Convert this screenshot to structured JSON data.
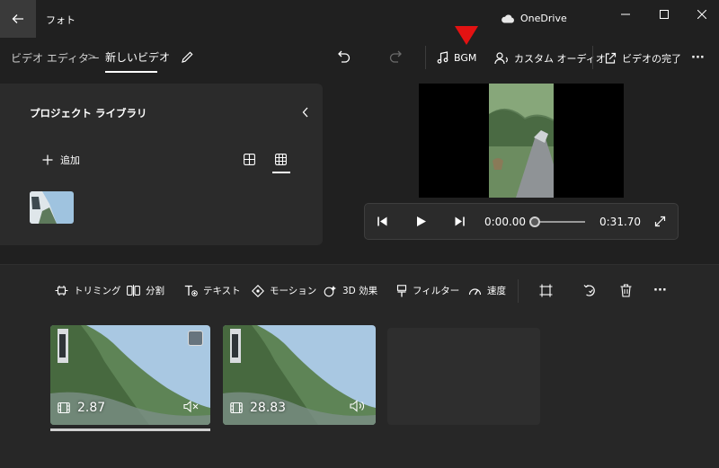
{
  "titlebar": {
    "app_title": "フォト",
    "onedrive_label": "OneDrive",
    "icons": [
      "back-arrow-icon",
      "cloud-icon",
      "minimize-icon",
      "maximize-icon",
      "close-icon"
    ]
  },
  "toolbar": {
    "breadcrumb_parent": "ビデオ エディター",
    "breadcrumb_separator": ">",
    "breadcrumb_current": "新しいビデオ",
    "bgm_label": "BGM",
    "custom_audio_label": "カスタム オーディオ",
    "finish_video_label": "ビデオの完了",
    "more_label": "···"
  },
  "library": {
    "title": "プロジェクト ライブラリ",
    "add_label": "追加"
  },
  "preview": {
    "current_time": "0:00.00",
    "total_time": "0:31.70",
    "progress": 0.0
  },
  "storyboard": {
    "tools": {
      "trim": "トリミング",
      "split": "分割",
      "text": "テキスト",
      "motion": "モーション",
      "effects_3d": "3D 効果",
      "filter": "フィルター",
      "speed": "速度",
      "more": "···"
    },
    "clips": [
      {
        "duration": "2.87",
        "audio": "muted",
        "selected": true
      },
      {
        "duration": "28.83",
        "audio": "on",
        "selected": false
      }
    ]
  },
  "annotation": {
    "arrow_color": "#e21212"
  },
  "colors": {
    "background": "#202020",
    "panel": "#2b2b2b",
    "storyboard": "#272727"
  }
}
